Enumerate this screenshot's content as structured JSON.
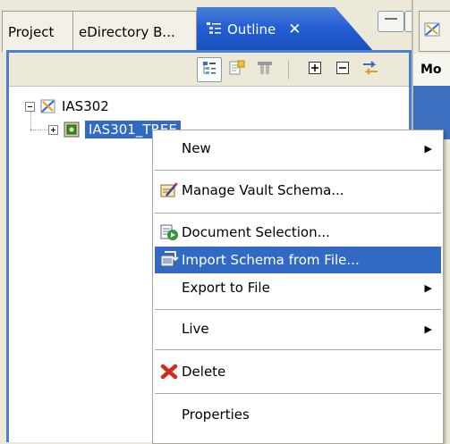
{
  "tabs": [
    {
      "label": "Project"
    },
    {
      "label": "eDirectory B..."
    },
    {
      "label": "Outline",
      "close": "✕"
    }
  ],
  "right_panel": {
    "header_text": "Mo"
  },
  "tree": {
    "root": {
      "label": "IAS302",
      "expander": "collapse"
    },
    "child": {
      "label": "IAS301_TREE",
      "expander": "expand",
      "selected": true
    }
  },
  "context_menu": {
    "items": [
      {
        "label": "New",
        "submenu": true
      },
      {
        "label": "Manage Vault Schema...",
        "icon": "vault-schema-icon"
      },
      {
        "label": "Document Selection...",
        "icon": "document-selection-icon"
      },
      {
        "label": "Import Schema from File...",
        "icon": "import-schema-icon",
        "highlighted": true
      },
      {
        "label": "Export to File",
        "submenu": true
      },
      {
        "label": "Live",
        "submenu": true
      },
      {
        "label": "Delete",
        "icon": "delete-icon"
      },
      {
        "label": "Properties"
      }
    ],
    "submenu_arrow": "▶"
  },
  "colors": {
    "active_tab": "#245ed5",
    "selection": "#316ac5",
    "menu_border": "#aca899",
    "panel_border": "#4b7fd6",
    "delete_red": "#d42a1a"
  }
}
